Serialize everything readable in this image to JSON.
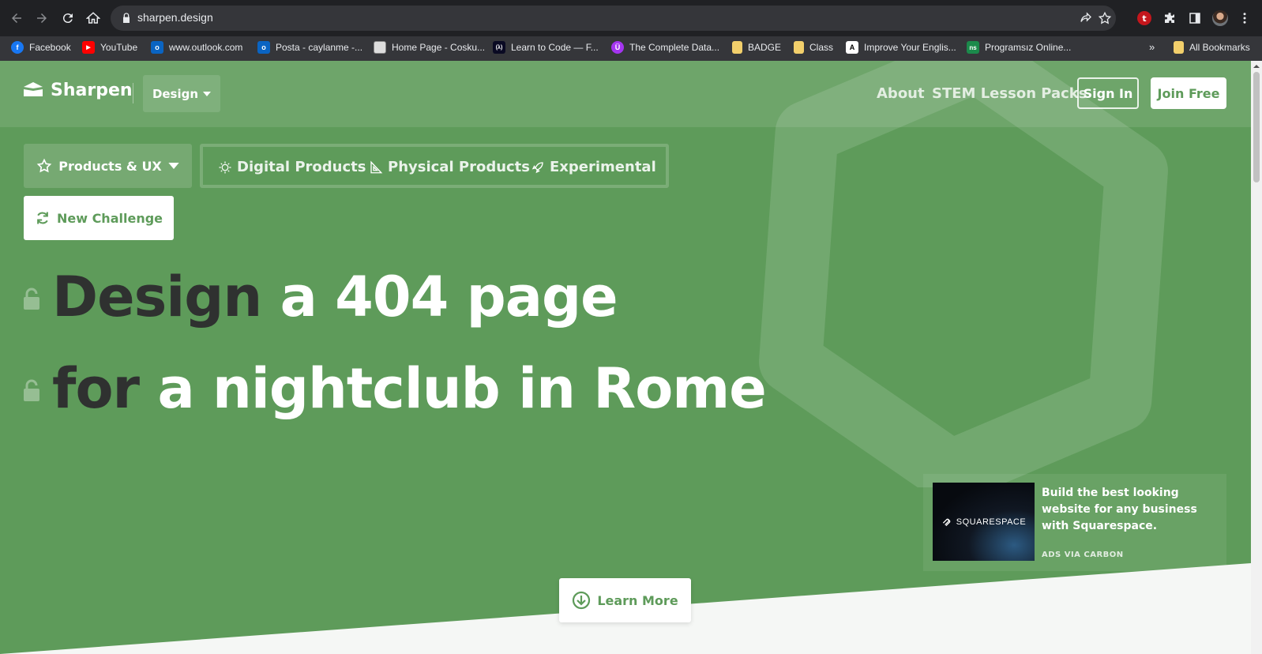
{
  "browser": {
    "url": "sharpen.design",
    "bookmarks": [
      {
        "label": "Facebook",
        "icon": "facebook-icon",
        "color": "#1877f2",
        "glyph": "f"
      },
      {
        "label": "YouTube",
        "icon": "youtube-icon",
        "color": "#ff0000",
        "glyph": "▶"
      },
      {
        "label": "www.outlook.com",
        "icon": "outlook-icon",
        "color": "#0a64c2",
        "glyph": "o"
      },
      {
        "label": "Posta - caylanme -...",
        "icon": "outlook-icon",
        "color": "#0a64c2",
        "glyph": "o"
      },
      {
        "label": "Home Page - Cosku...",
        "icon": "site-icon",
        "color": "#dddddd",
        "glyph": ""
      },
      {
        "label": "Learn to Code — F...",
        "icon": "freecodecamp-icon",
        "color": "#0a0a23",
        "glyph": "(λ)"
      },
      {
        "label": "The Complete Data...",
        "icon": "udemy-icon",
        "color": "#a435f0",
        "glyph": "Ü"
      },
      {
        "label": "BADGE",
        "icon": "folder-icon",
        "color": "#f2cf6b",
        "glyph": ""
      },
      {
        "label": "Class",
        "icon": "folder-icon",
        "color": "#f2cf6b",
        "glyph": ""
      },
      {
        "label": "Improve Your Englis...",
        "icon": "site-icon",
        "color": "#ffffff",
        "glyph": "A"
      },
      {
        "label": "Programsız Online...",
        "icon": "ns-icon",
        "color": "#1b8a4b",
        "glyph": "ns"
      }
    ],
    "all_bookmarks": "All Bookmarks"
  },
  "site": {
    "logo": "Sharpen",
    "design_menu": "Design",
    "nav": {
      "about": "About",
      "stem": "STEM Lesson Packs",
      "signin": "Sign In",
      "join": "Join Free"
    },
    "category_select": "Products & UX",
    "categories": {
      "digital": "Digital Products",
      "physical": "Physical Products",
      "experimental": "Experimental"
    },
    "new_challenge": "New Challenge",
    "prompt": {
      "line1_keyword": "Design",
      "line1_rest": "a 404 page",
      "line2_keyword": "for",
      "line2_rest": "a nightclub in Rome"
    },
    "ad": {
      "brand": "SQUARESPACE",
      "text": "Build the best looking website for any business with Squarespace.",
      "via": "ADS VIA CARBON"
    },
    "learn_more": "Learn More"
  },
  "colors": {
    "page_green": "#5e9b5a",
    "headline_dark": "#2f3130",
    "chrome_dark": "#202124"
  }
}
